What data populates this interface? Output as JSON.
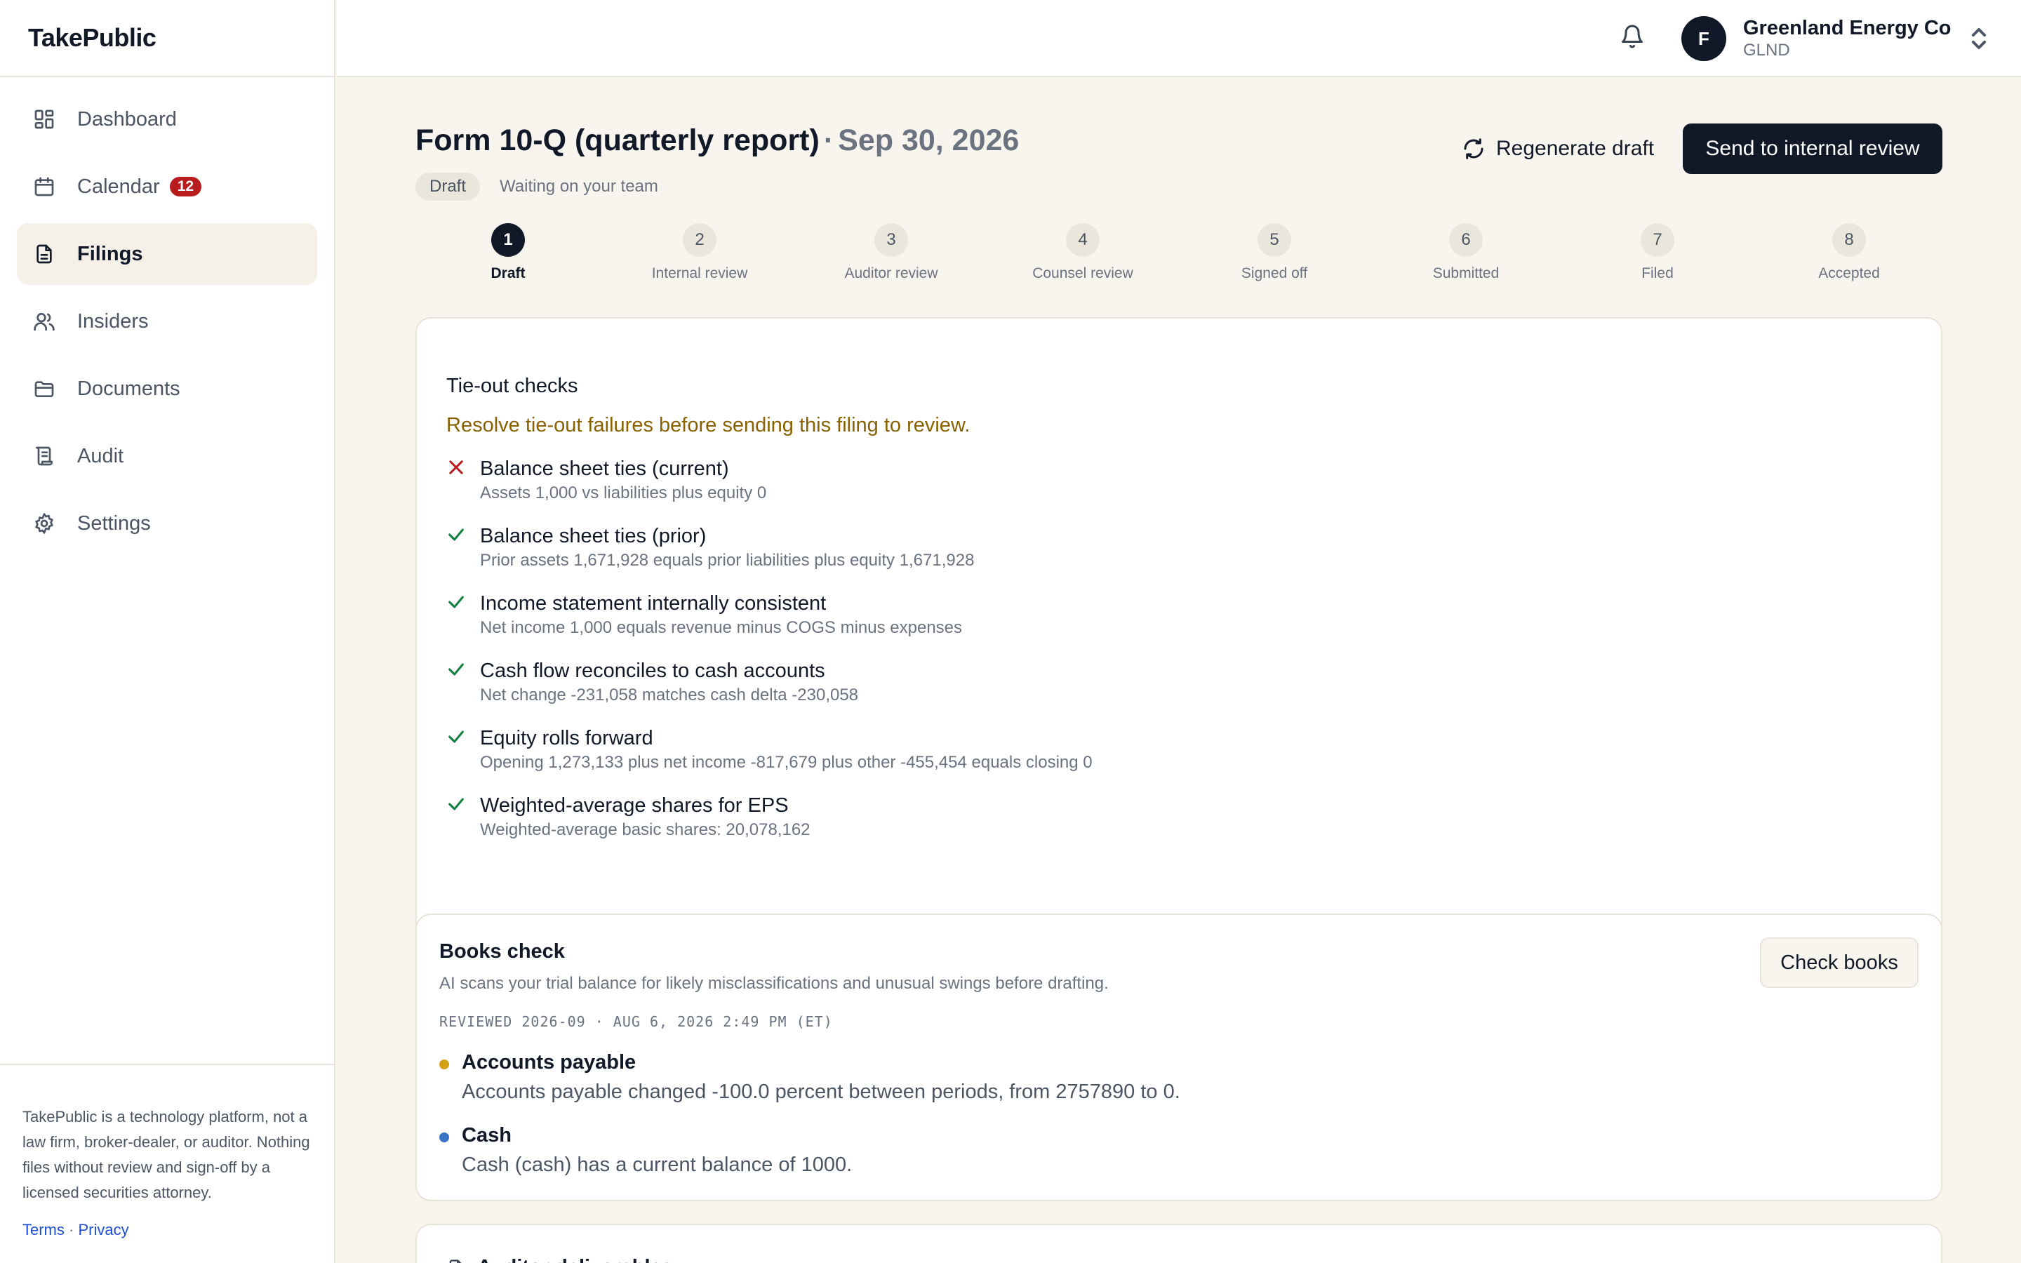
{
  "app": {
    "brand": "TakePublic"
  },
  "sidebar": {
    "items": [
      {
        "label": "Dashboard",
        "icon": "dashboard-icon"
      },
      {
        "label": "Calendar",
        "icon": "calendar-icon",
        "badge": "12"
      },
      {
        "label": "Filings",
        "icon": "file-icon",
        "active": true
      },
      {
        "label": "Insiders",
        "icon": "users-icon"
      },
      {
        "label": "Documents",
        "icon": "folder-icon"
      },
      {
        "label": "Audit",
        "icon": "scroll-icon"
      },
      {
        "label": "Settings",
        "icon": "gear-icon"
      }
    ],
    "disclaimer": "TakePublic is a technology platform, not a law firm, broker-dealer, or auditor. Nothing files without review and sign-off by a licensed securities attorney.",
    "terms": "Terms",
    "separator": "·",
    "privacy": "Privacy"
  },
  "topbar": {
    "avatar_initial": "F",
    "company_name": "Greenland Energy Co",
    "ticker": "GLND"
  },
  "header": {
    "title": "Form 10-Q (quarterly report)",
    "separator": "·",
    "period": "Sep 30, 2026",
    "status": "Draft",
    "status_note": "Waiting on your team",
    "regenerate_label": "Regenerate draft",
    "send_label": "Send to internal review"
  },
  "stepper": {
    "steps": [
      {
        "num": "1",
        "label": "Draft"
      },
      {
        "num": "2",
        "label": "Internal review"
      },
      {
        "num": "3",
        "label": "Auditor review"
      },
      {
        "num": "4",
        "label": "Counsel review"
      },
      {
        "num": "5",
        "label": "Signed off"
      },
      {
        "num": "6",
        "label": "Submitted"
      },
      {
        "num": "7",
        "label": "Filed"
      },
      {
        "num": "8",
        "label": "Accepted"
      }
    ],
    "current": 1
  },
  "tieout": {
    "title": "Tie-out checks",
    "warning": "Resolve tie-out failures before sending this filing to review.",
    "checks": [
      {
        "status": "fail",
        "title": "Balance sheet ties (current)",
        "detail": "Assets 1,000 vs liabilities plus equity 0"
      },
      {
        "status": "pass",
        "title": "Balance sheet ties (prior)",
        "detail": "Prior assets 1,671,928 equals prior liabilities plus equity 1,671,928"
      },
      {
        "status": "pass",
        "title": "Income statement internally consistent",
        "detail": "Net income 1,000 equals revenue minus COGS minus expenses"
      },
      {
        "status": "pass",
        "title": "Cash flow reconciles to cash accounts",
        "detail": "Net change -231,058 matches cash delta -230,058"
      },
      {
        "status": "pass",
        "title": "Equity rolls forward",
        "detail": "Opening 1,273,133 plus net income -817,679 plus other -455,454 equals closing 0"
      },
      {
        "status": "pass",
        "title": "Weighted-average shares for EPS",
        "detail": "Weighted-average basic shares: 20,078,162"
      }
    ]
  },
  "books": {
    "title": "Books check",
    "subtitle": "AI scans your trial balance for likely misclassifications and unusual swings before drafting.",
    "reviewed": "REVIEWED 2026-09 · AUG 6, 2026 2:49 PM (ET)",
    "button": "Check books",
    "findings": [
      {
        "title": "Accounts payable",
        "description": "Accounts payable changed -100.0 percent between periods, from 2757890 to 0.",
        "color": "#d4a017"
      },
      {
        "title": "Cash",
        "description": "Cash (cash) has a current balance of 1000.",
        "color": "#3b74c4"
      }
    ]
  },
  "next_card": {
    "title": "Auditor deliverables"
  },
  "colors": {
    "primary": "#111827",
    "warning": "#8a6100",
    "pass": "#15803d",
    "fail": "#b91c1c",
    "badge": "#b91c1c",
    "accent_bg": "#f6f1e8"
  }
}
